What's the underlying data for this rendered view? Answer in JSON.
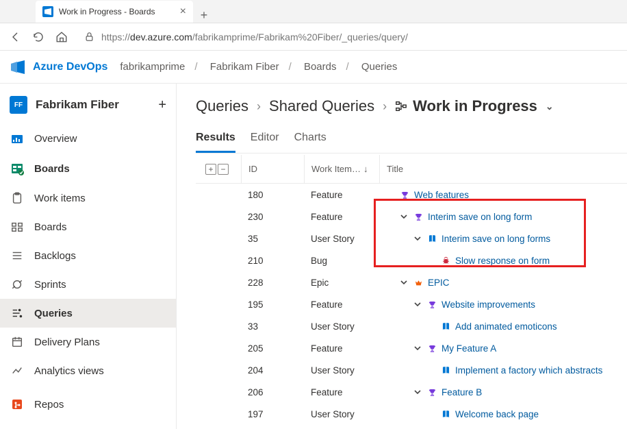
{
  "browser": {
    "tab_title": "Work in Progress - Boards",
    "url_prefix": "https://",
    "url_host": "dev.azure.com",
    "url_path": "/fabrikamprime/Fabrikam%20Fiber/_queries/query/"
  },
  "header": {
    "product": "Azure DevOps",
    "crumbs": [
      "fabrikamprime",
      "Fabrikam Fiber",
      "Boards",
      "Queries"
    ]
  },
  "sidebar": {
    "project_initials": "FF",
    "project_name": "Fabrikam Fiber",
    "items": [
      {
        "label": "Overview"
      },
      {
        "label": "Boards"
      },
      {
        "label": "Work items"
      },
      {
        "label": "Boards"
      },
      {
        "label": "Backlogs"
      },
      {
        "label": "Sprints"
      },
      {
        "label": "Queries"
      },
      {
        "label": "Delivery Plans"
      },
      {
        "label": "Analytics views"
      },
      {
        "label": "Repos"
      }
    ]
  },
  "breadcrumb": {
    "root": "Queries",
    "folder": "Shared Queries",
    "current": "Work in Progress"
  },
  "tabs": {
    "results": "Results",
    "editor": "Editor",
    "charts": "Charts"
  },
  "cols": {
    "id": "ID",
    "type": "Work Item…",
    "title": "Title"
  },
  "rows": [
    {
      "id": "180",
      "type": "Feature",
      "title": "Web features",
      "icon": "trophy",
      "indent": 0,
      "expand": false
    },
    {
      "id": "230",
      "type": "Feature",
      "title": "Interim save on long form",
      "icon": "trophy",
      "indent": 1,
      "expand": true
    },
    {
      "id": "35",
      "type": "User Story",
      "title": "Interim save on long forms",
      "icon": "book",
      "indent": 2,
      "expand": true
    },
    {
      "id": "210",
      "type": "Bug",
      "title": "Slow response on form",
      "icon": "bug",
      "indent": 3,
      "expand": false
    },
    {
      "id": "228",
      "type": "Epic",
      "title": "EPIC",
      "icon": "crown",
      "indent": 1,
      "expand": true
    },
    {
      "id": "195",
      "type": "Feature",
      "title": "Website improvements",
      "icon": "trophy",
      "indent": 2,
      "expand": true
    },
    {
      "id": "33",
      "type": "User Story",
      "title": "Add animated emoticons",
      "icon": "book",
      "indent": 3,
      "expand": false
    },
    {
      "id": "205",
      "type": "Feature",
      "title": "My Feature A",
      "icon": "trophy",
      "indent": 2,
      "expand": true
    },
    {
      "id": "204",
      "type": "User Story",
      "title": "Implement a factory which abstracts",
      "icon": "book",
      "indent": 3,
      "expand": false
    },
    {
      "id": "206",
      "type": "Feature",
      "title": "Feature B",
      "icon": "trophy",
      "indent": 2,
      "expand": true
    },
    {
      "id": "197",
      "type": "User Story",
      "title": "Welcome back page",
      "icon": "book",
      "indent": 3,
      "expand": false
    }
  ]
}
